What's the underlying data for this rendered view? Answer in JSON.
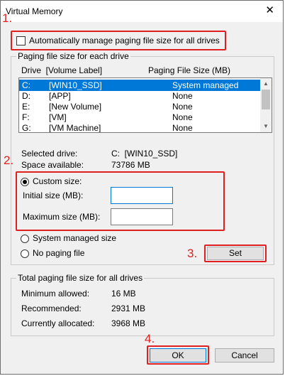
{
  "window": {
    "title": "Virtual Memory",
    "close_symbol": "✕"
  },
  "auto_manage": {
    "label": "Automatically manage paging file size for all drives",
    "checked": false
  },
  "paging_group": {
    "title": "Paging file size for each drive",
    "col_drive": "Drive  [Volume Label]",
    "col_size": "Paging File Size (MB)",
    "drives": [
      {
        "letter": "C:",
        "label": "[WIN10_SSD]",
        "size": "System managed",
        "selected": true
      },
      {
        "letter": "D:",
        "label": "[APP]",
        "size": "None"
      },
      {
        "letter": "E:",
        "label": "[New Volume]",
        "size": "None"
      },
      {
        "letter": "F:",
        "label": "[VM]",
        "size": "None"
      },
      {
        "letter": "G:",
        "label": "[VM Machine]",
        "size": "None"
      }
    ],
    "selected_drive_label": "Selected drive:",
    "selected_drive_value": "C:  [WIN10_SSD]",
    "space_available_label": "Space available:",
    "space_available_value": "73786 MB",
    "custom_size_label": "Custom size:",
    "initial_size_label": "Initial size (MB):",
    "initial_size_value": "",
    "maximum_size_label": "Maximum size (MB):",
    "maximum_size_value": "",
    "system_managed_label": "System managed size",
    "no_paging_label": "No paging file",
    "set_label": "Set",
    "selected_option": "custom"
  },
  "total_group": {
    "title": "Total paging file size for all drives",
    "min_label": "Minimum allowed:",
    "min_value": "16 MB",
    "rec_label": "Recommended:",
    "rec_value": "2931 MB",
    "cur_label": "Currently allocated:",
    "cur_value": "3968 MB"
  },
  "buttons": {
    "ok": "OK",
    "cancel": "Cancel"
  },
  "annotations": {
    "step1": "1.",
    "step2": "2.",
    "step3": "3.",
    "step4": "4."
  },
  "colors": {
    "highlight_red": "#e02020",
    "selection_blue": "#0078d7"
  }
}
